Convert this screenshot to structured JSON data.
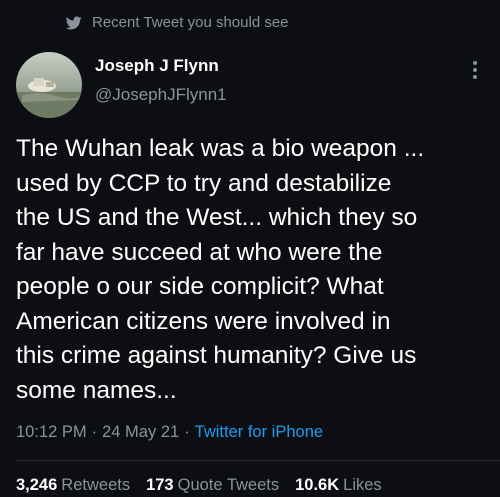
{
  "context": {
    "icon": "twitter-bird-icon",
    "label": "Recent Tweet you should see"
  },
  "author": {
    "name": "Joseph J Flynn",
    "handle": "@JosephJFlynn1",
    "avatar_icon": "profile-photo"
  },
  "tweet": {
    "text": "The Wuhan leak was a bio weapon ...\nused by CCP to try and destabilize\nthe US and the West... which they so\nfar have succeed at who were the\npeople o our side complicit?  What\nAmerican citizens were involved in\nthis crime against humanity? Give us\nsome names..."
  },
  "meta": {
    "time": "10:12 PM",
    "date": "24 May 21",
    "separator": "·",
    "source": "Twitter for iPhone"
  },
  "stats": {
    "retweets_count": "3,246",
    "retweets_label": "Retweets",
    "quotes_count": "173",
    "quotes_label": "Quote Tweets",
    "likes_count": "10.6K",
    "likes_label": "Likes"
  },
  "colors": {
    "background": "#0d0e12",
    "text_primary": "#ffffff",
    "text_secondary": "#8a939b",
    "link": "#1d9bf0"
  }
}
